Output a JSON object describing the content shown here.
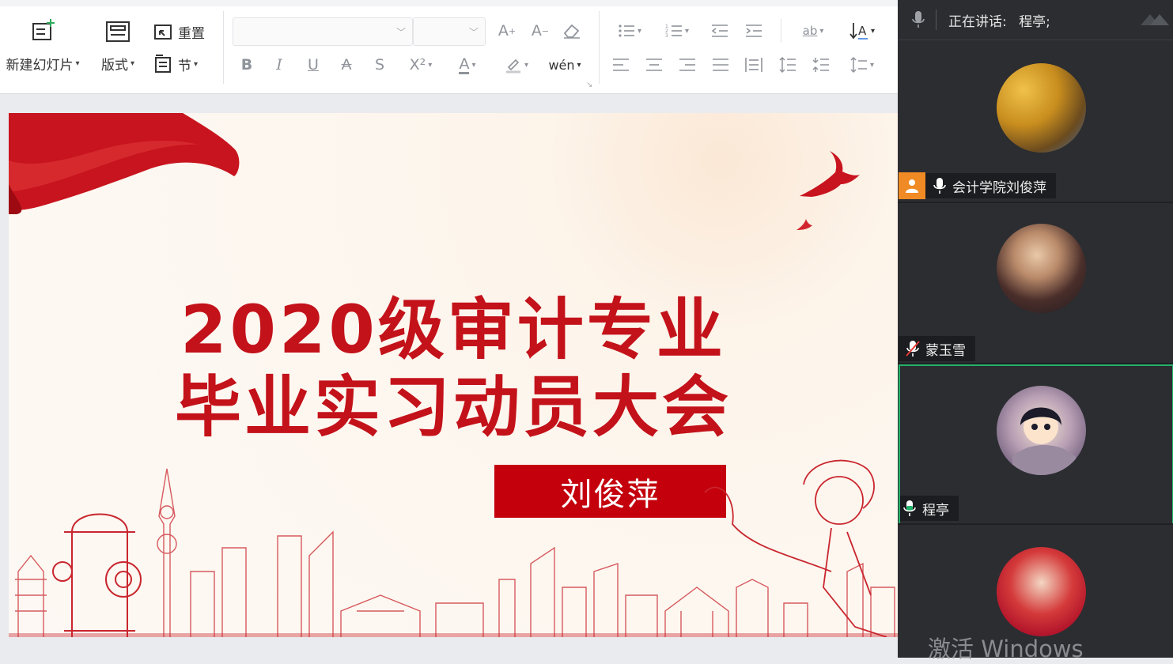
{
  "ribbon": {
    "new_slide_label": "新建幻灯片",
    "layout_label": "版式",
    "reset_label": "重置",
    "section_label": "节",
    "font_name_placeholder": "",
    "font_size_placeholder": "",
    "bold": "B",
    "italic": "I",
    "underline": "U",
    "strike": "A",
    "shadow": "S",
    "superscript": "X²",
    "font_color_glyph": "A",
    "phonetic_glyph": "wén"
  },
  "slide": {
    "title_line1": "2020级审计专业",
    "title_line2": "毕业实习动员大会",
    "presenter": "刘俊萍",
    "accent_color": "#c3121a"
  },
  "meeting": {
    "speaking_label": "正在讲话:",
    "speaking_name": "程亭;",
    "participants": [
      {
        "name": "会计学院刘俊萍",
        "role": "host",
        "mic": "on",
        "avatar": "golden-tree-photo"
      },
      {
        "name": "蒙玉雪",
        "role": "attendee",
        "mic": "muted",
        "avatar": "woman-portrait-photo"
      },
      {
        "name": "程亭",
        "role": "attendee",
        "mic": "speaking",
        "avatar": "cartoon-girl-avatar"
      },
      {
        "name": "",
        "role": "attendee",
        "mic": "on",
        "avatar": "man-red-background-photo"
      }
    ],
    "active_color": "#23b36b",
    "host_color": "#f08a24"
  },
  "watermark": "激活 Windows"
}
